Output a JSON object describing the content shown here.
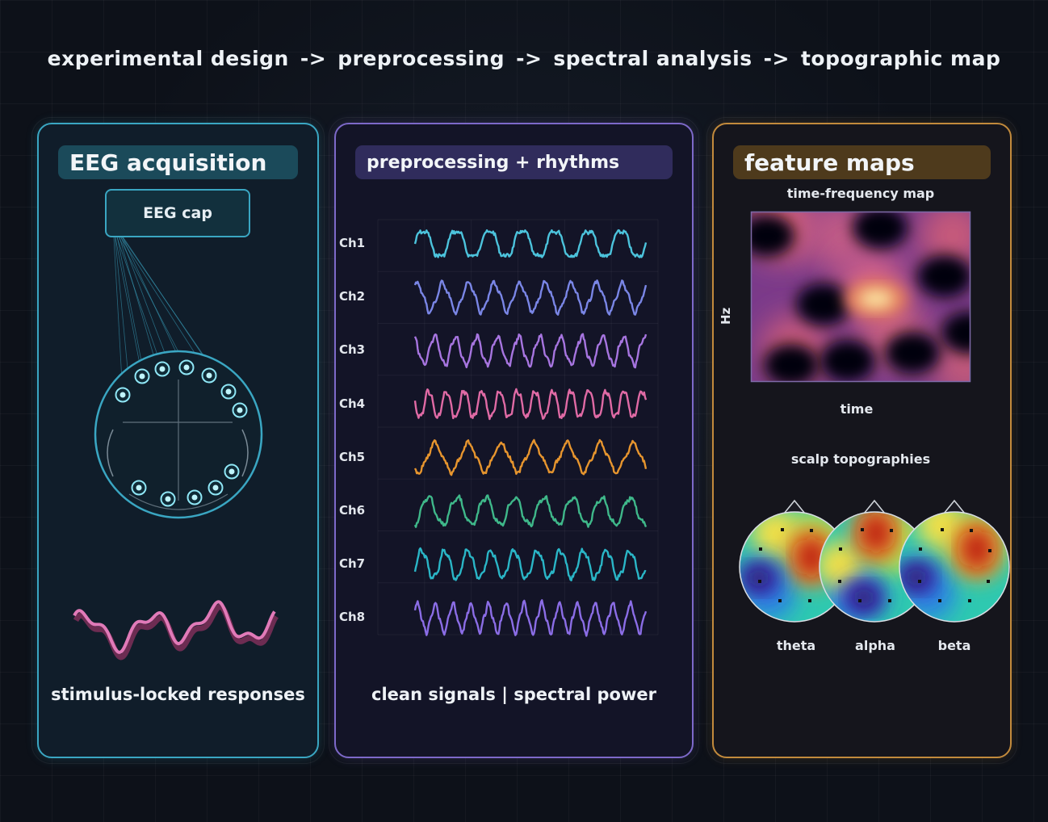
{
  "pipeline": {
    "steps": [
      "experimental design",
      "preprocessing",
      "spectral analysis",
      "topographic map"
    ],
    "separator": "->"
  },
  "panels": {
    "acquisition": {
      "title": "EEG acquisition",
      "cap_label": "EEG cap",
      "caption": "stimulus-locked responses",
      "color": "#3aa6c2"
    },
    "preprocessing": {
      "title": "preprocessing + rhythms",
      "caption": "clean signals | spectral power",
      "color": "#7d69c9",
      "channels": [
        {
          "label": "Ch1",
          "color": "#4cc3dc",
          "cycles": 7
        },
        {
          "label": "Ch2",
          "color": "#7a86e6",
          "cycles": 9
        },
        {
          "label": "Ch3",
          "color": "#a775e0",
          "cycles": 11
        },
        {
          "label": "Ch4",
          "color": "#e06aa5",
          "cycles": 13
        },
        {
          "label": "Ch5",
          "color": "#e7952e",
          "cycles": 7
        },
        {
          "label": "Ch6",
          "color": "#3fb88a",
          "cycles": 8
        },
        {
          "label": "Ch7",
          "color": "#2ab6c7",
          "cycles": 10
        },
        {
          "label": "Ch8",
          "color": "#8b6de6",
          "cycles": 13
        }
      ]
    },
    "features": {
      "title": "feature maps",
      "color": "#c28a3c",
      "tf_map": {
        "title": "time-frequency map",
        "xlabel": "time",
        "ylabel": "Hz"
      },
      "topo_title": "scalp topographies",
      "bands": [
        "theta",
        "alpha",
        "beta"
      ]
    }
  }
}
